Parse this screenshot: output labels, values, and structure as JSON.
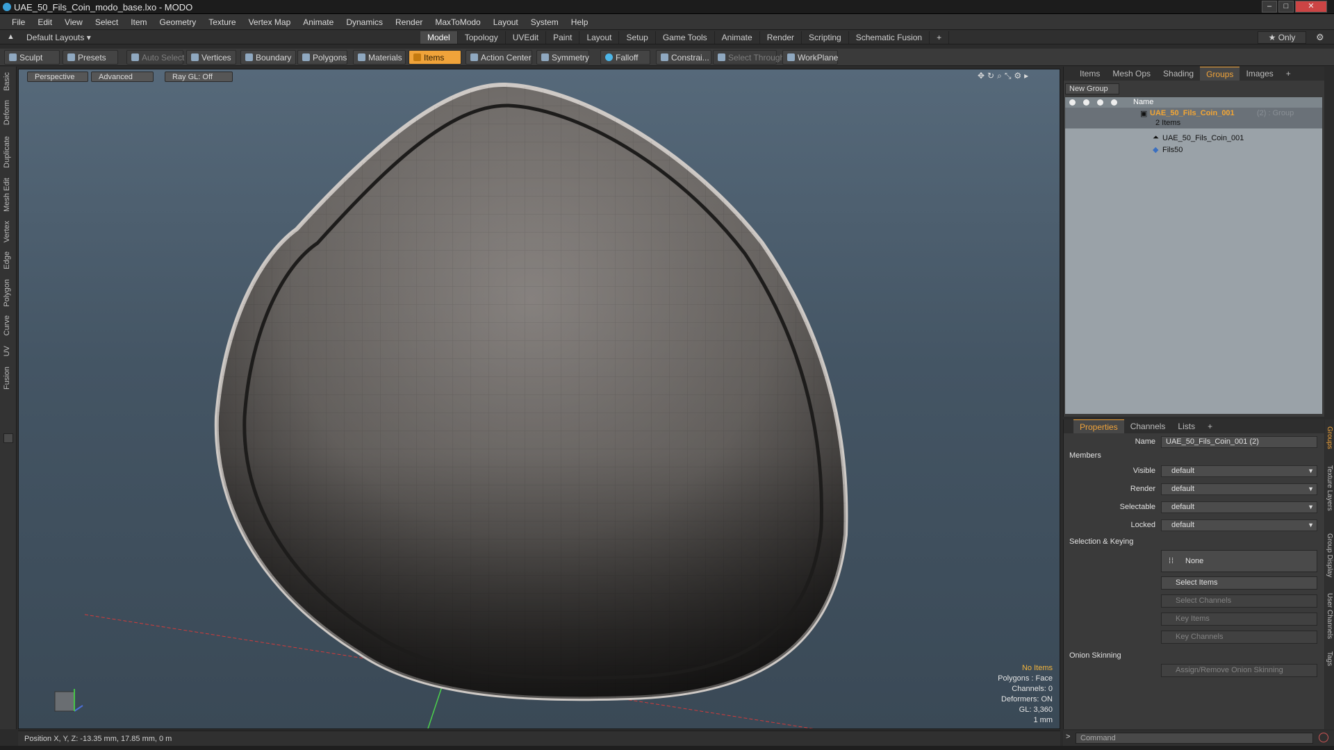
{
  "window": {
    "title": "UAE_50_Fils_Coin_modo_base.lxo - MODO"
  },
  "menu": [
    "File",
    "Edit",
    "View",
    "Select",
    "Item",
    "Geometry",
    "Texture",
    "Vertex Map",
    "Animate",
    "Dynamics",
    "Render",
    "MaxToModo",
    "Layout",
    "System",
    "Help"
  ],
  "layoutbar": {
    "default_layouts": "Default Layouts ▾",
    "tabs": [
      "Model",
      "Topology",
      "UVEdit",
      "Paint",
      "Layout",
      "Setup",
      "Game Tools",
      "Animate",
      "Render",
      "Scripting",
      "Schematic Fusion"
    ],
    "active_tab": "Model",
    "only_label": "★ Only"
  },
  "toolbar": {
    "sculpt": "Sculpt",
    "presets": "Presets",
    "auto_select": "Auto Select",
    "vertices": "Vertices",
    "boundary": "Boundary",
    "polygons": "Polygons",
    "materials": "Materials",
    "items": "Items",
    "action_center": "Action Center",
    "symmetry": "Symmetry",
    "falloff": "Falloff",
    "constrain": "Constrai...",
    "select_through": "Select Through",
    "workplane": "WorkPlane"
  },
  "left_tabs": [
    "Basic",
    "Deform",
    "Duplicate",
    "Mesh Edit",
    "Vertex",
    "Edge",
    "Polygon",
    "Curve",
    "UV",
    "Fusion"
  ],
  "viewport": {
    "perspective": "Perspective",
    "advanced": "Advanced",
    "raygl": "Ray GL: Off",
    "hud": {
      "no_items": "No Items",
      "polygons": "Polygons : Face",
      "channels": "Channels: 0",
      "deformers": "Deformers: ON",
      "gl": "GL: 3,360",
      "scale": "1 mm"
    }
  },
  "status": {
    "position": "Position X, Y, Z:  -13.35 mm, 17.85 mm, 0 m"
  },
  "right_top": {
    "tabs": [
      "Items",
      "Mesh Ops",
      "Shading",
      "Groups",
      "Images"
    ],
    "active_tab": "Groups",
    "new_group": "New Group",
    "column_name": "Name",
    "group_name": "UAE_50_Fils_Coin_001",
    "group_suffix": "(2) : Group",
    "group_count": "2 Items",
    "children": [
      "UAE_50_Fils_Coin_001",
      "Fils50"
    ]
  },
  "properties": {
    "tabs": [
      "Properties",
      "Channels",
      "Lists"
    ],
    "active_tab": "Properties",
    "name_label": "Name",
    "name_value": "UAE_50_Fils_Coin_001 (2)",
    "members_section": "Members",
    "visible_label": "Visible",
    "visible_value": "default",
    "render_label": "Render",
    "render_value": "default",
    "selectable_label": "Selectable",
    "selectable_value": "default",
    "locked_label": "Locked",
    "locked_value": "default",
    "selection_section": "Selection & Keying",
    "none_btn": "None",
    "select_items": "Select Items",
    "select_channels": "Select Channels",
    "key_items": "Key Items",
    "key_channels": "Key Channels",
    "onion_section": "Onion Skinning",
    "onion_btn": "Assign/Remove Onion Skinning"
  },
  "right_side_tabs": [
    "Groups",
    "Texture Layers",
    "Group Display",
    "User Channels",
    "Tags"
  ],
  "command": {
    "placeholder": "Command"
  }
}
